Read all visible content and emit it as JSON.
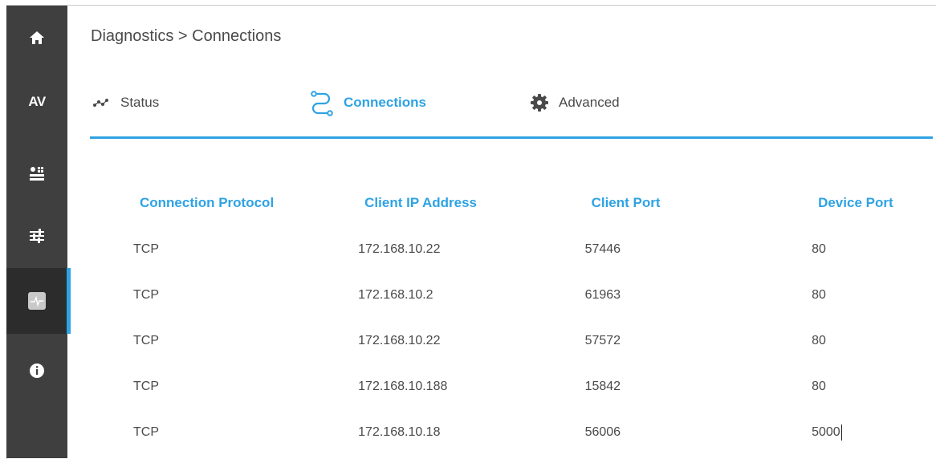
{
  "sidebar": {
    "items": [
      {
        "name": "home",
        "icon": "home-icon"
      },
      {
        "name": "av",
        "label": "AV"
      },
      {
        "name": "devices",
        "icon": "device-settings-icon"
      },
      {
        "name": "adjustments",
        "icon": "sliders-icon"
      },
      {
        "name": "diagnostics",
        "icon": "diagnostics-icon",
        "active": true
      },
      {
        "name": "info",
        "icon": "info-icon"
      }
    ]
  },
  "header": {
    "breadcrumb": "Diagnostics > Connections"
  },
  "tabs": [
    {
      "label": "Status",
      "icon": "status-graph-icon"
    },
    {
      "label": "Connections",
      "icon": "connections-icon",
      "active": true
    },
    {
      "label": "Advanced",
      "icon": "gear-icon"
    }
  ],
  "table": {
    "headers": [
      "Connection Protocol",
      "Client IP Address",
      "Client Port",
      "Device Port"
    ],
    "rows": [
      [
        "TCP",
        "172.168.10.22",
        "57446",
        "80"
      ],
      [
        "TCP",
        "172.168.10.2",
        "61963",
        "80"
      ],
      [
        "TCP",
        "172.168.10.22",
        "57572",
        "80"
      ],
      [
        "TCP",
        "172.168.10.188",
        "15842",
        "80"
      ],
      [
        "TCP",
        "172.168.10.18",
        "56006",
        "5000"
      ]
    ]
  },
  "colors": {
    "accent": "#2ea3e3",
    "sidebar": "#3f3f3f",
    "sidebar_active": "#2c2c2c"
  }
}
